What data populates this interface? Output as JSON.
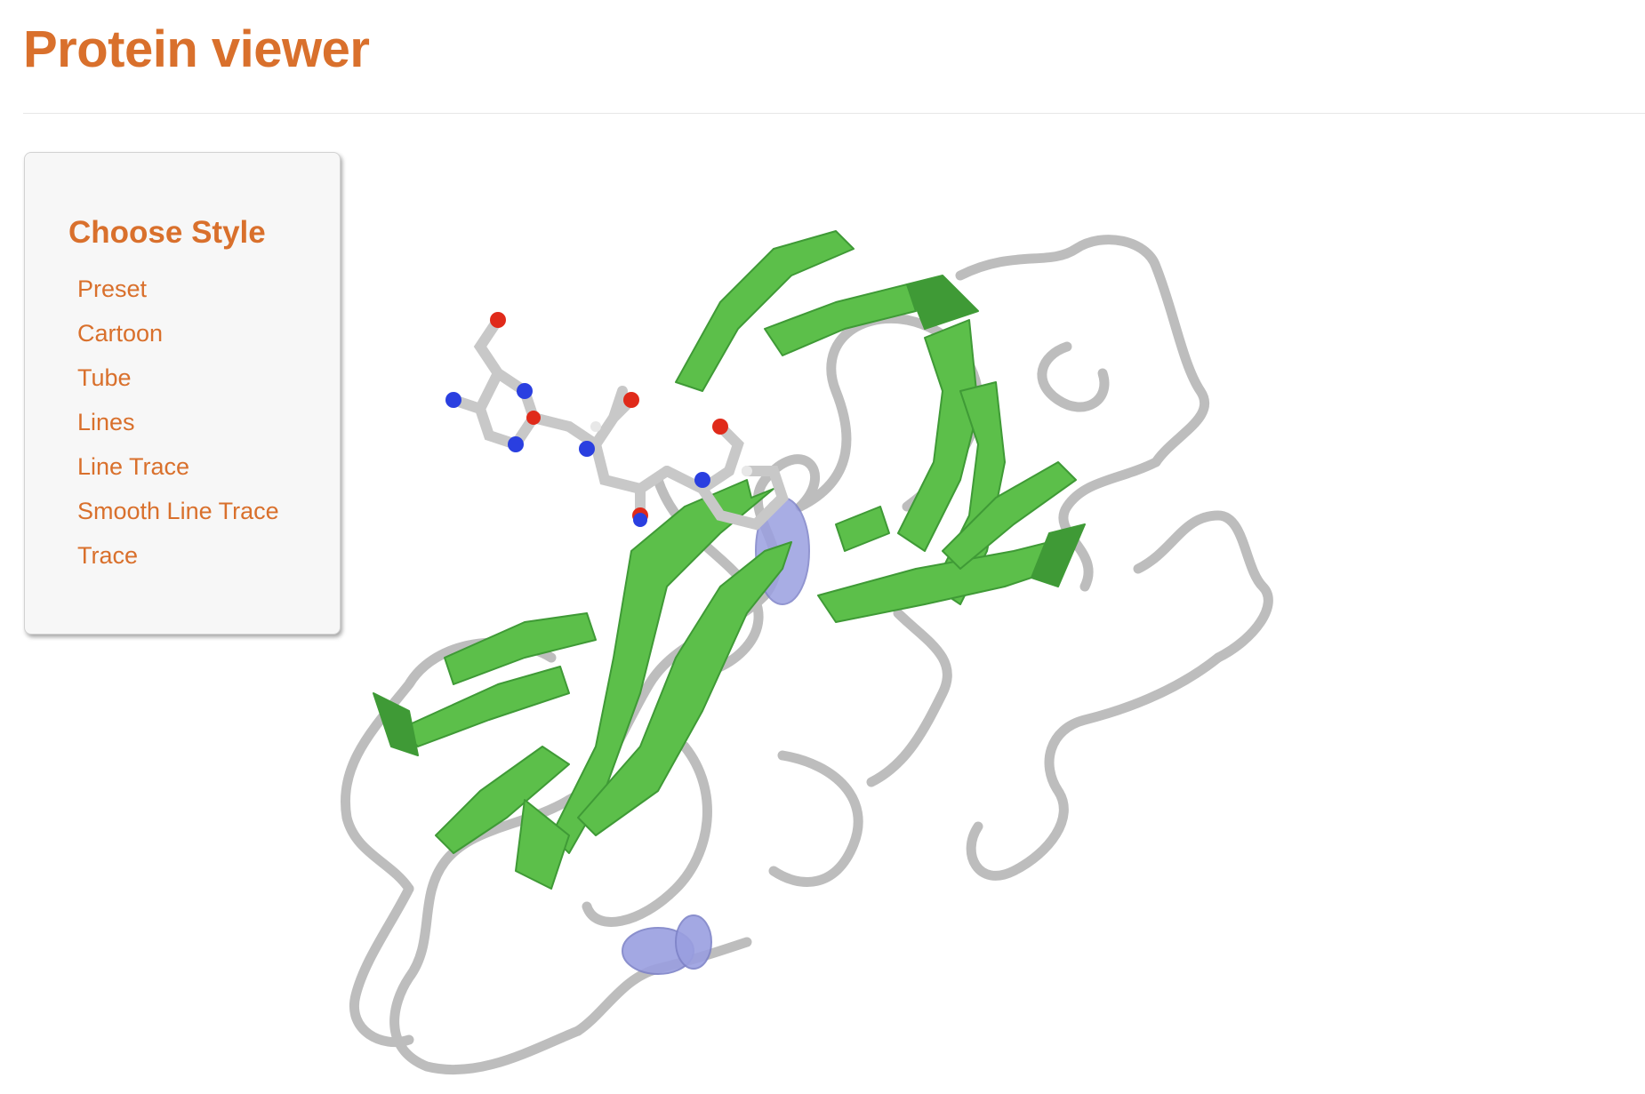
{
  "page": {
    "title": "Protein viewer"
  },
  "style_panel": {
    "heading": "Choose Style",
    "items": [
      {
        "label": "Preset"
      },
      {
        "label": "Cartoon"
      },
      {
        "label": "Tube"
      },
      {
        "label": "Lines"
      },
      {
        "label": "Line Trace"
      },
      {
        "label": "Smooth Line Trace"
      },
      {
        "label": "Trace"
      }
    ]
  },
  "viewer": {
    "representation": "cartoon with ligand sticks",
    "colors": {
      "accent": "#d9702c",
      "strand": "#5cbf4a",
      "strand_dark": "#3f9a36",
      "helix": "#9a9fe0",
      "coil": "#bdbdbd",
      "nitrogen": "#2a3fe0",
      "oxygen": "#e02a1a",
      "carbon": "#c8c8c8"
    }
  }
}
